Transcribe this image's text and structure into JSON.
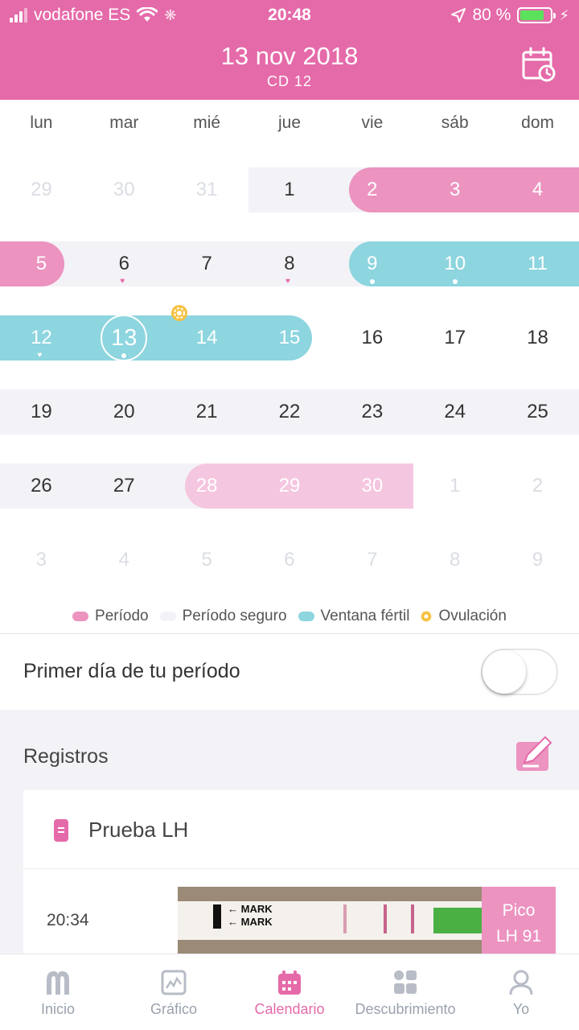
{
  "status_bar": {
    "carrier": "vodafone ES",
    "time": "20:48",
    "battery": "80 %",
    "battery_level": 0.8
  },
  "header": {
    "title": "13 nov 2018",
    "subtitle": "CD 12",
    "calendar_icon": "calendar-clock-icon"
  },
  "calendar": {
    "weekdays": [
      "lun",
      "mar",
      "mié",
      "jue",
      "vie",
      "sáb",
      "dom"
    ],
    "weeks": [
      [
        "29",
        "30",
        "31",
        "1",
        "2",
        "3",
        "4"
      ],
      [
        "5",
        "6",
        "7",
        "8",
        "9",
        "10",
        "11"
      ],
      [
        "12",
        "13",
        "14",
        "15",
        "16",
        "17",
        "18"
      ],
      [
        "19",
        "20",
        "21",
        "22",
        "23",
        "24",
        "25"
      ],
      [
        "26",
        "27",
        "28",
        "29",
        "30",
        "1",
        "2"
      ],
      [
        "3",
        "4",
        "5",
        "6",
        "7",
        "8",
        "9"
      ]
    ],
    "colors": {
      "period": "#ec93c0",
      "safe": "#f3f3f7",
      "fertile": "#8dd5df",
      "predicted_period": "#f5c6df",
      "ovulation": "#f5c242",
      "accent": "#e56aa9"
    }
  },
  "legend": [
    {
      "label": "Período",
      "color": "#ec93c0"
    },
    {
      "label": "Período seguro",
      "color": "#f3f3f7"
    },
    {
      "label": "Ventana fértil",
      "color": "#8dd5df"
    },
    {
      "label": "Ovulación",
      "color": "#f5c242"
    }
  ],
  "first_day": {
    "label": "Primer día de tu período",
    "toggle_on": false
  },
  "registros": {
    "title": "Registros",
    "card": {
      "name": "Prueba LH",
      "time": "20:34",
      "strip_text_1": "MARK",
      "strip_text_2": "MARK",
      "result_line_1": "Pico",
      "result_line_2": "LH 91"
    }
  },
  "nav": [
    {
      "label": "Inicio",
      "icon": "home-arch-icon"
    },
    {
      "label": "Gráfico",
      "icon": "chart-icon"
    },
    {
      "label": "Calendario",
      "icon": "calendar-icon",
      "active": true
    },
    {
      "label": "Descubrimiento",
      "icon": "discover-icon"
    },
    {
      "label": "Yo",
      "icon": "person-icon"
    }
  ]
}
